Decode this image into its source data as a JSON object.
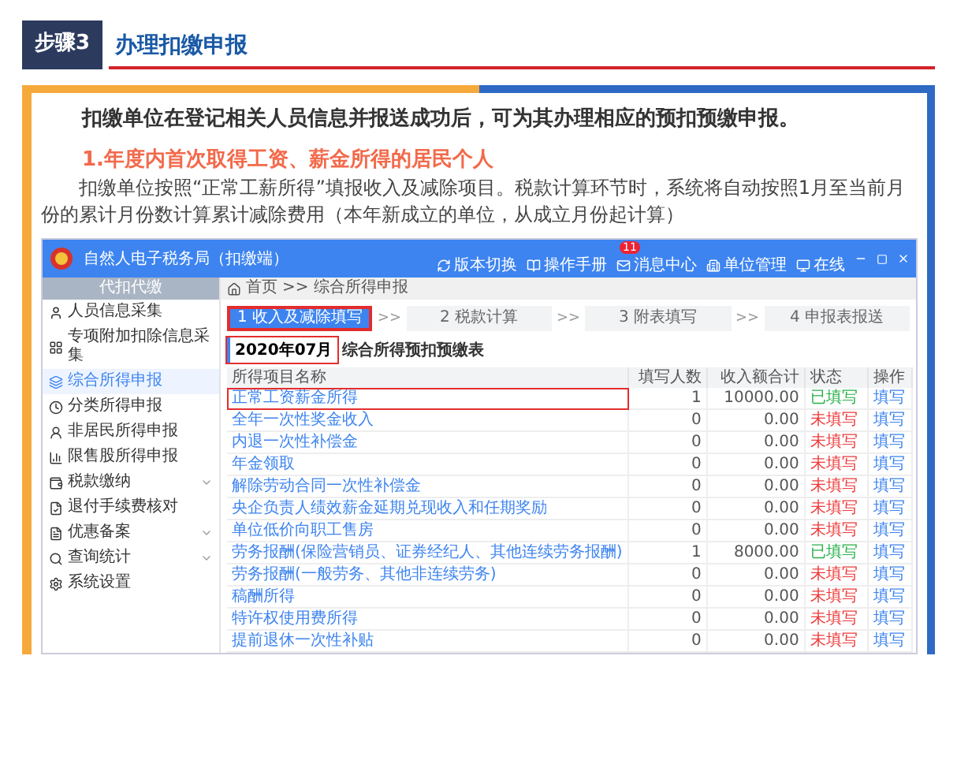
{
  "step": {
    "badge": "步骤3",
    "title": "办理扣缴申报"
  },
  "article": {
    "intro": "扣缴单位在登记相关人员信息并报送成功后，可为其办理相应的预扣预缴申报。",
    "heading": "1.年度内首次取得工资、薪金所得的居民个人",
    "body": "扣缴单位按照“正常工薪所得”填报收入及减除项目。税款计算环节时，系统将自动按照1月至当前月份的累计月份数计算累计减除费用（本年新成立的单位，从成立月份起计算）"
  },
  "app": {
    "title": "自然人电子税务局（扣缴端）",
    "toolbar": [
      {
        "label": "版本切换"
      },
      {
        "label": "操作手册"
      },
      {
        "label": "消息中心",
        "badge": "11"
      },
      {
        "label": "单位管理"
      },
      {
        "label": "在线"
      }
    ],
    "sidebar": {
      "header": "代扣代缴",
      "items": [
        {
          "label": "人员信息采集",
          "selected": false,
          "expandable": false
        },
        {
          "label": "专项附加扣除信息采集",
          "selected": false,
          "expandable": false
        },
        {
          "label": "综合所得申报",
          "selected": true,
          "expandable": false
        },
        {
          "label": "分类所得申报",
          "selected": false,
          "expandable": false
        },
        {
          "label": "非居民所得申报",
          "selected": false,
          "expandable": false
        },
        {
          "label": "限售股所得申报",
          "selected": false,
          "expandable": false
        },
        {
          "label": "税款缴纳",
          "selected": false,
          "expandable": true
        },
        {
          "label": "退付手续费核对",
          "selected": false,
          "expandable": false
        },
        {
          "label": "优惠备案",
          "selected": false,
          "expandable": true
        },
        {
          "label": "查询统计",
          "selected": false,
          "expandable": true
        },
        {
          "label": "系统设置",
          "selected": false,
          "expandable": false
        }
      ]
    },
    "breadcrumb": [
      "首页",
      ">>",
      "综合所得申报"
    ],
    "steps": [
      {
        "label": "1 收入及减除填写",
        "selected": true,
        "highlighted": true
      },
      {
        "label": "2 税款计算",
        "selected": false,
        "highlighted": false
      },
      {
        "label": "3 附表填写",
        "selected": false,
        "highlighted": false
      },
      {
        "label": "4 申报表报送",
        "selected": false,
        "highlighted": false
      }
    ],
    "step_separator": ">>",
    "period": {
      "date": "2020年07月",
      "highlighted": true,
      "title": "综合所得预扣预缴表"
    },
    "table": {
      "columns": [
        "所得项目名称",
        "填写人数",
        "收入额合计",
        "状态",
        "操作"
      ],
      "rows": [
        {
          "name": "正常工资薪金所得",
          "count": "1",
          "total": "10000.00",
          "status": "已填写",
          "filled": true,
          "action": "填写",
          "highlighted": true
        },
        {
          "name": "全年一次性奖金收入",
          "count": "0",
          "total": "0.00",
          "status": "未填写",
          "filled": false,
          "action": "填写",
          "highlighted": false
        },
        {
          "name": "内退一次性补偿金",
          "count": "0",
          "total": "0.00",
          "status": "未填写",
          "filled": false,
          "action": "填写",
          "highlighted": false
        },
        {
          "name": "年金领取",
          "count": "0",
          "total": "0.00",
          "status": "未填写",
          "filled": false,
          "action": "填写",
          "highlighted": false
        },
        {
          "name": "解除劳动合同一次性补偿金",
          "count": "0",
          "total": "0.00",
          "status": "未填写",
          "filled": false,
          "action": "填写",
          "highlighted": false
        },
        {
          "name": "央企负责人绩效薪金延期兑现收入和任期奖励",
          "count": "0",
          "total": "0.00",
          "status": "未填写",
          "filled": false,
          "action": "填写",
          "highlighted": false
        },
        {
          "name": "单位低价向职工售房",
          "count": "0",
          "total": "0.00",
          "status": "未填写",
          "filled": false,
          "action": "填写",
          "highlighted": false
        },
        {
          "name": "劳务报酬(保险营销员、证券经纪人、其他连续劳务报酬)",
          "count": "1",
          "total": "8000.00",
          "status": "已填写",
          "filled": true,
          "action": "填写",
          "highlighted": false
        },
        {
          "name": "劳务报酬(一般劳务、其他非连续劳务)",
          "count": "0",
          "total": "0.00",
          "status": "未填写",
          "filled": false,
          "action": "填写",
          "highlighted": false
        },
        {
          "name": "稿酬所得",
          "count": "0",
          "total": "0.00",
          "status": "未填写",
          "filled": false,
          "action": "填写",
          "highlighted": false
        },
        {
          "name": "特许权使用费所得",
          "count": "0",
          "total": "0.00",
          "status": "未填写",
          "filled": false,
          "action": "填写",
          "highlighted": false
        },
        {
          "name": "提前退休一次性补贴",
          "count": "0",
          "total": "0.00",
          "status": "未填写",
          "filled": false,
          "action": "填写",
          "highlighted": false
        }
      ]
    }
  }
}
